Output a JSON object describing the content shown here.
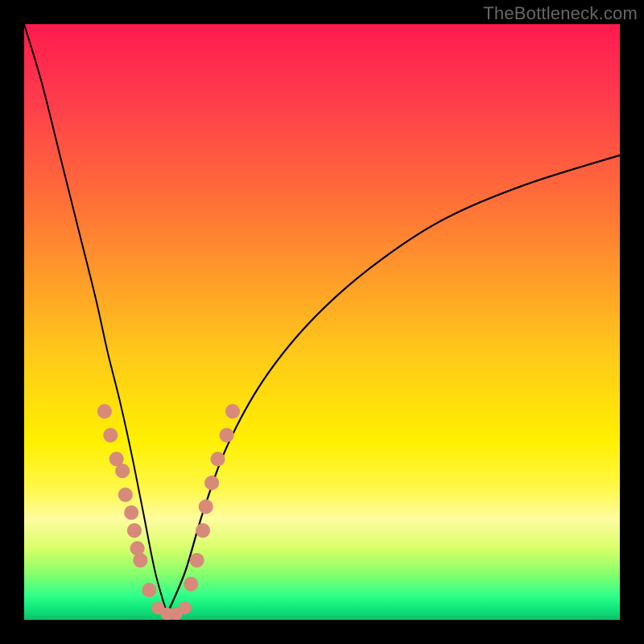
{
  "watermark": "TheBottleneck.com",
  "colors": {
    "background": "#000000",
    "gradient_top": "#ff1a4d",
    "gradient_bottom": "#0ec06a",
    "curve": "#000000",
    "dots": "#d88a7a"
  },
  "chart_data": {
    "type": "line",
    "title": "",
    "xlabel": "",
    "ylabel": "",
    "xlim": [
      0,
      100
    ],
    "ylim": [
      0,
      100
    ],
    "notes": "Two-branch V-shaped bottleneck curve over a vertical rainbow gradient (red→green). y ≈ 100 at x=0, dips to ~0 near x≈24, rises back toward ~78 at x=100. Scatter dots cluster along both branches near the bottom of the V (roughly y<35).",
    "series": [
      {
        "name": "left-branch",
        "x": [
          0,
          3,
          6,
          9,
          12,
          14,
          16,
          18,
          20,
          22,
          24
        ],
        "y": [
          100,
          90,
          78,
          66,
          54,
          45,
          37,
          28,
          18,
          8,
          1
        ]
      },
      {
        "name": "right-branch",
        "x": [
          24,
          27,
          30,
          34,
          40,
          48,
          58,
          70,
          84,
          100
        ],
        "y": [
          1,
          8,
          18,
          29,
          40,
          50,
          59,
          67,
          73,
          78
        ]
      }
    ],
    "scatter": [
      {
        "x": 13.5,
        "y": 35
      },
      {
        "x": 14.5,
        "y": 31
      },
      {
        "x": 15.5,
        "y": 27
      },
      {
        "x": 16.5,
        "y": 25
      },
      {
        "x": 17.0,
        "y": 21
      },
      {
        "x": 18.0,
        "y": 18
      },
      {
        "x": 18.5,
        "y": 15
      },
      {
        "x": 19.0,
        "y": 12
      },
      {
        "x": 19.5,
        "y": 10
      },
      {
        "x": 21.0,
        "y": 5
      },
      {
        "x": 22.5,
        "y": 2
      },
      {
        "x": 24.0,
        "y": 1
      },
      {
        "x": 25.5,
        "y": 1
      },
      {
        "x": 27.0,
        "y": 2
      },
      {
        "x": 28.0,
        "y": 6
      },
      {
        "x": 29.0,
        "y": 10
      },
      {
        "x": 30.0,
        "y": 15
      },
      {
        "x": 30.5,
        "y": 19
      },
      {
        "x": 31.5,
        "y": 23
      },
      {
        "x": 32.5,
        "y": 27
      },
      {
        "x": 34.0,
        "y": 31
      },
      {
        "x": 35.0,
        "y": 35
      }
    ]
  }
}
